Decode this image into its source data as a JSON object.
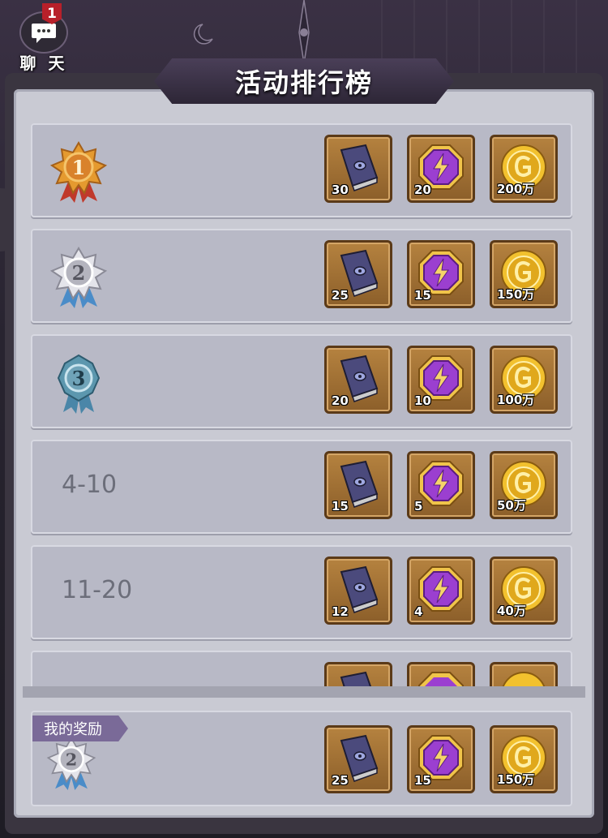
{
  "chat": {
    "label": "聊 天",
    "badge": "1"
  },
  "title": "活动排行榜",
  "rows": [
    {
      "rank_label": "",
      "medal": "gold",
      "medal_number": "1",
      "items": [
        {
          "icon": "book-icon",
          "qty": "30"
        },
        {
          "icon": "energy-crystal-icon",
          "qty": "20"
        },
        {
          "icon": "gold-coin-icon",
          "qty": "200万"
        }
      ]
    },
    {
      "rank_label": "",
      "medal": "silver",
      "medal_number": "2",
      "items": [
        {
          "icon": "book-icon",
          "qty": "25"
        },
        {
          "icon": "energy-crystal-icon",
          "qty": "15"
        },
        {
          "icon": "gold-coin-icon",
          "qty": "150万"
        }
      ]
    },
    {
      "rank_label": "",
      "medal": "bronze",
      "medal_number": "3",
      "items": [
        {
          "icon": "book-icon",
          "qty": "20"
        },
        {
          "icon": "energy-crystal-icon",
          "qty": "10"
        },
        {
          "icon": "gold-coin-icon",
          "qty": "100万"
        }
      ]
    },
    {
      "rank_label": "4-10",
      "items": [
        {
          "icon": "book-icon",
          "qty": "15"
        },
        {
          "icon": "energy-crystal-icon",
          "qty": "5"
        },
        {
          "icon": "gold-coin-icon",
          "qty": "50万"
        }
      ]
    },
    {
      "rank_label": "11-20",
      "items": [
        {
          "icon": "book-icon",
          "qty": "12"
        },
        {
          "icon": "energy-crystal-icon",
          "qty": "4"
        },
        {
          "icon": "gold-coin-icon",
          "qty": "40万"
        }
      ]
    }
  ],
  "my_reward": {
    "tag": "我的奖励",
    "medal_number": "2",
    "items": [
      {
        "icon": "book-icon",
        "qty": "25"
      },
      {
        "icon": "energy-crystal-icon",
        "qty": "15"
      },
      {
        "icon": "gold-coin-icon",
        "qty": "150万"
      }
    ]
  },
  "colors": {
    "gold": "#d9822b",
    "silver": "#c9c9cf",
    "bronze": "#6fa3b8",
    "purple": "#9b3fd0",
    "coin": "#f2c12e"
  }
}
